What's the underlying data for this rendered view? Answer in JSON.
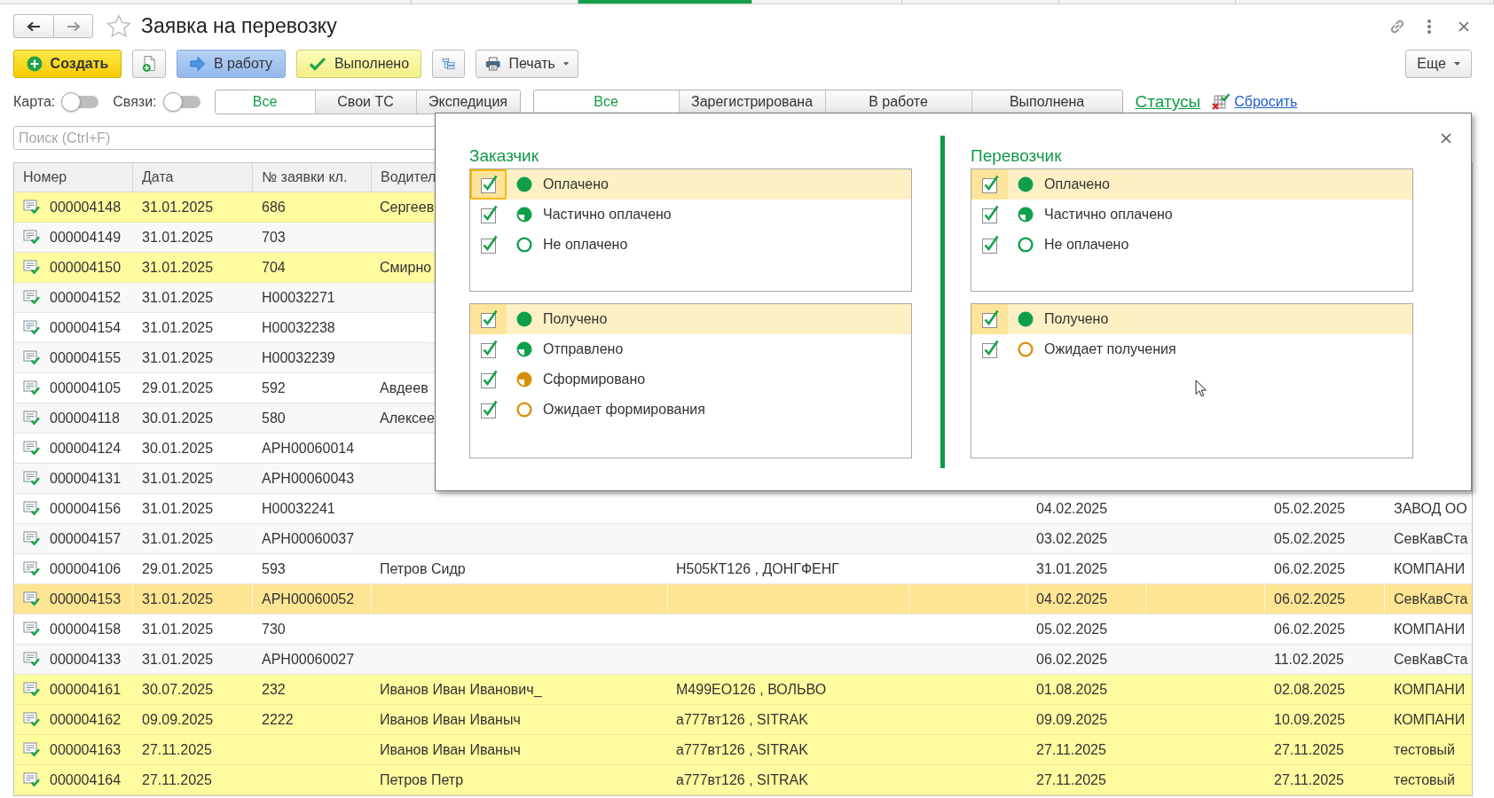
{
  "browser_tabs": [
    {
      "selected": false
    },
    {
      "selected": false
    },
    {
      "selected": true
    },
    {
      "selected": false
    },
    {
      "selected": false
    },
    {
      "selected": false
    },
    {
      "selected": false
    }
  ],
  "window": {
    "title": "Заявка на перевозку",
    "favorite": false
  },
  "toolbar": {
    "buttons": [
      {
        "kind": "create",
        "label": "Создать"
      },
      {
        "kind": "add_document"
      },
      {
        "kind": "to_work",
        "label": "В работу"
      },
      {
        "kind": "done",
        "label": "Выполнено"
      },
      {
        "kind": "structure"
      },
      {
        "kind": "print",
        "label": "Печать"
      }
    ],
    "more": "Еще"
  },
  "filters": {
    "toggles": [
      {
        "label": "Карта:",
        "on": false
      },
      {
        "label": "Связи:",
        "on": false
      }
    ],
    "tab_groups": [
      {
        "tabs": [
          {
            "label": "Все",
            "selected": true
          },
          {
            "label": "Свои ТС",
            "selected": false
          },
          {
            "label": "Экспедиция",
            "selected": false
          }
        ]
      },
      {
        "tabs": [
          {
            "label": "Все",
            "selected": true
          },
          {
            "label": "Зарегистрирована",
            "selected": false
          },
          {
            "label": "В работе",
            "selected": false
          },
          {
            "label": "Выполнена",
            "selected": false
          }
        ]
      }
    ],
    "statuses_link": "Статусы",
    "reset_link": "Сбросить"
  },
  "search": {
    "placeholder": "Поиск (Ctrl+F)"
  },
  "table": {
    "columns": [
      {
        "label": "Номер"
      },
      {
        "label": "Дата"
      },
      {
        "label": "№ заявки кл."
      },
      {
        "label": "Водител"
      }
    ],
    "rows": [
      {
        "number": "000004148",
        "date": "31.01.2025",
        "client_no": "686",
        "driver": "Сергеев",
        "highlighted": true,
        "selected": false
      },
      {
        "number": "000004149",
        "date": "31.01.2025",
        "client_no": "703",
        "highlighted": false,
        "selected": false
      },
      {
        "number": "000004150",
        "date": "31.01.2025",
        "client_no": "704",
        "driver": "Смирно",
        "highlighted": true,
        "selected": false
      },
      {
        "number": "000004152",
        "date": "31.01.2025",
        "client_no": "Н00032271",
        "highlighted": false,
        "selected": false
      },
      {
        "number": "000004154",
        "date": "31.01.2025",
        "client_no": "Н00032238",
        "highlighted": false,
        "selected": false
      },
      {
        "number": "000004155",
        "date": "31.01.2025",
        "client_no": "Н00032239",
        "highlighted": false,
        "selected": false
      },
      {
        "number": "000004105",
        "date": "29.01.2025",
        "client_no": "592",
        "driver": "Авдеев",
        "highlighted": false,
        "selected": false
      },
      {
        "number": "000004118",
        "date": "30.01.2025",
        "client_no": "580",
        "driver": "Алексее",
        "highlighted": false,
        "selected": false
      },
      {
        "number": "000004124",
        "date": "30.01.2025",
        "client_no": "АРН00060014",
        "highlighted": false,
        "selected": false
      },
      {
        "number": "000004131",
        "date": "31.01.2025",
        "client_no": "АРН00060043",
        "highlighted": false,
        "selected": false
      },
      {
        "number": "000004156",
        "date": "31.01.2025",
        "client_no": "Н00032241",
        "column_7": "04.02.2025",
        "column_9": "05.02.2025",
        "column_10": "ЗАВОД ОО",
        "highlighted": false,
        "selected": false
      },
      {
        "number": "000004157",
        "date": "31.01.2025",
        "client_no": "АРН00060037",
        "column_7": "03.02.2025",
        "column_9": "05.02.2025",
        "column_10": "СевКавСта",
        "highlighted": false,
        "selected": false
      },
      {
        "number": "000004106",
        "date": "29.01.2025",
        "client_no": "593",
        "driver": "Петров Сидр",
        "column_5": "Н505КТ126 , ДОНГФЕНГ",
        "column_7": "31.01.2025",
        "column_9": "06.02.2025",
        "column_10": "КОМПАНИ",
        "highlighted": false,
        "selected": false
      },
      {
        "number": "000004153",
        "date": "31.01.2025",
        "client_no": "АРН00060052",
        "column_7": "04.02.2025",
        "column_9": "06.02.2025",
        "column_10": "СевКавСта",
        "highlighted": false,
        "selected": true
      },
      {
        "number": "000004158",
        "date": "31.01.2025",
        "client_no": "730",
        "column_7": "05.02.2025",
        "column_9": "06.02.2025",
        "column_10": "КОМПАНИ",
        "highlighted": false,
        "selected": false
      },
      {
        "number": "000004133",
        "date": "31.01.2025",
        "client_no": "АРН00060027",
        "column_7": "06.02.2025",
        "column_9": "11.02.2025",
        "column_10": "СевКавСта",
        "highlighted": false,
        "selected": false
      },
      {
        "number": "000004161",
        "date": "30.07.2025",
        "client_no": "232",
        "driver": "Иванов Иван Иванович_",
        "column_5": "М499ЕО126 , ВОЛЬВО",
        "column_7": "01.08.2025",
        "column_9": "02.08.2025",
        "column_10": "КОМПАНИ",
        "highlighted": true,
        "selected": false
      },
      {
        "number": "000004162",
        "date": "09.09.2025",
        "client_no": "2222",
        "driver": "Иванов Иван Иваныч",
        "column_5": "а777вт126 , SITRAK",
        "column_7": "09.09.2025",
        "column_9": "10.09.2025",
        "column_10": "КОМПАНИ",
        "highlighted": true,
        "selected": false
      },
      {
        "number": "000004163",
        "date": "27.11.2025",
        "driver": "Иванов Иван Иваныч",
        "column_5": "а777вт126 , SITRAK",
        "column_7": "27.11.2025",
        "column_9": "27.11.2025",
        "column_10": "тестовый",
        "highlighted": true,
        "selected": false
      },
      {
        "number": "000004164",
        "date": "27.11.2025",
        "driver": "Петров Петр",
        "column_5": "а777вт126 , SITRAK",
        "column_7": "27.11.2025",
        "column_9": "27.11.2025",
        "column_10": "тестовый",
        "highlighted": true,
        "selected": false
      }
    ]
  },
  "status_popup": {
    "sections": [
      {
        "title": "Заказчик",
        "groups": [
          {
            "items": [
              {
                "label": "Оплачено",
                "kind": "full",
                "color": "#0f9f4a",
                "checked": true,
                "selected": true,
                "focused": true
              },
              {
                "label": "Частично оплачено",
                "kind": "partial",
                "color": "#0f9f4a",
                "checked": true,
                "selected": false,
                "focused": false
              },
              {
                "label": "Не оплачено",
                "kind": "empty",
                "color": "#0f9f4a",
                "checked": true,
                "selected": false,
                "focused": false
              }
            ]
          },
          {
            "items": [
              {
                "label": "Получено",
                "kind": "full",
                "color": "#0f9f4a",
                "checked": true,
                "selected": true,
                "focused": false
              },
              {
                "label": "Отправлено",
                "kind": "partial",
                "color": "#0f9f4a",
                "checked": true,
                "selected": false,
                "focused": false
              },
              {
                "label": "Сформировано",
                "kind": "partial",
                "color": "#d98e0a",
                "checked": true,
                "selected": false,
                "focused": false
              },
              {
                "label": "Ожидает формирования",
                "kind": "empty",
                "color": "#d98e0a",
                "checked": true,
                "selected": false,
                "focused": false
              }
            ]
          }
        ]
      },
      {
        "title": "Перевозчик",
        "groups": [
          {
            "items": [
              {
                "label": "Оплачено",
                "kind": "full",
                "color": "#0f9f4a",
                "checked": true,
                "selected": true,
                "focused": false
              },
              {
                "label": "Частично оплачено",
                "kind": "partial",
                "color": "#0f9f4a",
                "checked": true,
                "selected": false,
                "focused": false
              },
              {
                "label": "Не оплачено",
                "kind": "empty",
                "color": "#0f9f4a",
                "checked": true,
                "selected": false,
                "focused": false
              }
            ]
          },
          {
            "items": [
              {
                "label": "Получено",
                "kind": "full",
                "color": "#0f9f4a",
                "checked": true,
                "selected": true,
                "focused": false
              },
              {
                "label": "Ожидает получения",
                "kind": "empty",
                "color": "#d98e0a",
                "checked": true,
                "selected": false,
                "focused": false
              }
            ]
          }
        ]
      }
    ]
  }
}
